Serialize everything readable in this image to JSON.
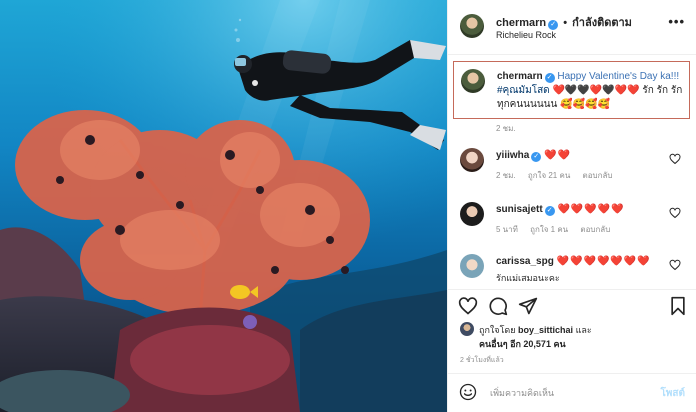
{
  "photo": {
    "subject": "scuba diver over red sea fan coral"
  },
  "header": {
    "username": "chermarn",
    "verified_glyph": "✓",
    "separator": "•",
    "follow_label": "กำลังติดตาม",
    "location": "Richelieu Rock",
    "more_label": "•••"
  },
  "caption": {
    "username": "chermarn",
    "text_prefix": "Happy Valentine's Day ka!!!",
    "hashtag": "#คุณมัมโสด",
    "hearts": "❤️🖤🖤❤️🖤❤️❤️",
    "text_suffix": "รัก รัก รัก ทุกคนนนนนน",
    "emojis": "🥰🥰🥰🥰",
    "time": "2 ชม."
  },
  "comments": [
    {
      "username": "yiiiwha",
      "text": "❤️❤️",
      "time": "2 ชม.",
      "likes": "ถูกใจ 21 คน",
      "reply": "ตอบกลับ"
    },
    {
      "username": "sunisajett",
      "text": "❤️❤️❤️❤️❤️",
      "time": "5 นาที",
      "likes": "ถูกใจ 1 คน",
      "reply": "ตอบกลับ"
    },
    {
      "username": "carissa_spg",
      "text": "❤️❤️❤️❤️❤️❤️❤️",
      "subtext": "รักแม่เสมอนะคะ"
    }
  ],
  "likes": {
    "line1_prefix": "ถูกใจโดย",
    "line1_user": "boy_sittichai",
    "line1_suffix": "และ",
    "line2_user": "คนอื่นๆ อีก 20,571 คน"
  },
  "post_time": "2 ชั่วโมงที่แล้ว",
  "add_comment": {
    "placeholder": "เพิ่มความคิดเห็น",
    "post_label": "โพสต์"
  },
  "colors": {
    "verified": "#3897f0",
    "hashtag": "#00376b",
    "post_disabled": "#b2dffc",
    "caption_border": "#c56a5a"
  }
}
